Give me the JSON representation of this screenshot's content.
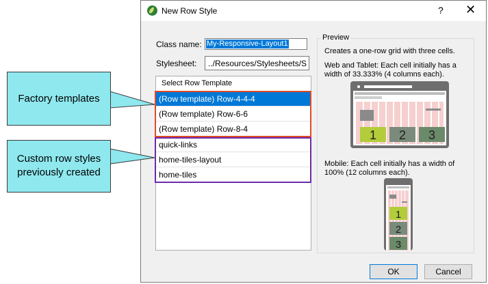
{
  "dialog": {
    "title": "New Row Style",
    "help_label": "?",
    "close_label": "✕",
    "class_name_label": "Class name:",
    "class_name_value": "My-Responsive-Layout1",
    "stylesheet_label": "Stylesheet:",
    "stylesheet_value": "../Resources/Stylesheets/S",
    "list_header": "Select Row Template",
    "factory_templates": [
      "(Row template) Row-4-4-4",
      "(Row template) Row-6-6",
      "(Row template) Row-8-4"
    ],
    "custom_styles": [
      "quick-links",
      "home-tiles-layout",
      "home-tiles"
    ],
    "selected_item": "(Row template) Row-4-4-4",
    "preview_label": "Preview",
    "preview_desc": "Creates a one-row grid with three cells.",
    "web_tablet_line1": "Web and Tablet: Each cell initially has a",
    "web_tablet_line2": "width of 33.333% (4 columns each).",
    "mobile_line1": "Mobile: Each cell initially has a width of",
    "mobile_line2": "100% (12 columns each).",
    "preview_cells": [
      "1",
      "2",
      "3"
    ],
    "ok_label": "OK",
    "cancel_label": "Cancel"
  },
  "callouts": {
    "factory": "Factory templates",
    "custom_line1": "Custom row styles",
    "custom_line2": "previously created"
  },
  "colors": {
    "selection": "#0078d7",
    "factory_outline": "#e04a25",
    "custom_outline": "#6a2aa8",
    "callout_fill": "#8ee8ee",
    "cell1": "#b3cc3a",
    "cell2": "#7b8b7b",
    "cell3": "#6a8a6a"
  }
}
